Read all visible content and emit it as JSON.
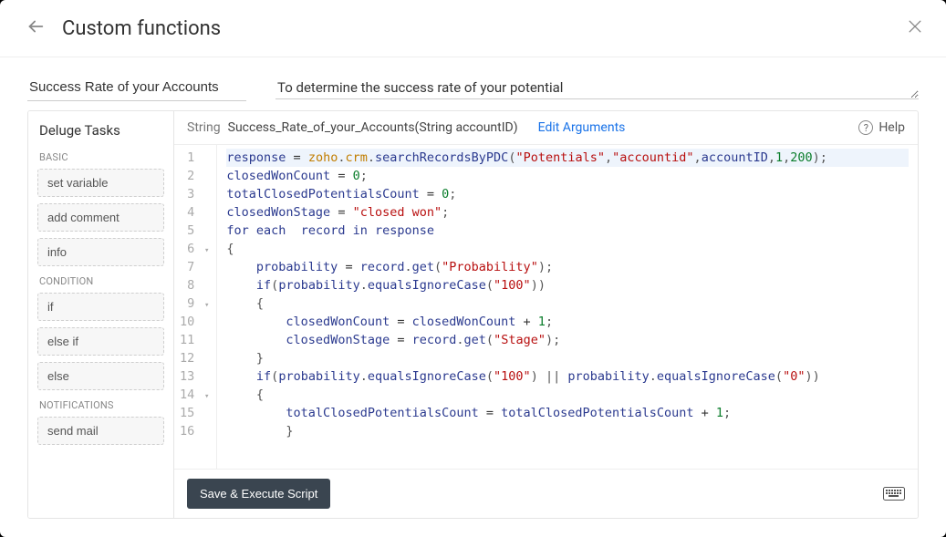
{
  "header": {
    "title": "Custom functions"
  },
  "form": {
    "function_name": "Success Rate of your Accounts",
    "description": "To determine the success rate of your potential"
  },
  "sidebar": {
    "title": "Deluge Tasks",
    "sections": [
      {
        "label": "BASIC",
        "items": [
          "set variable",
          "add comment",
          "info"
        ]
      },
      {
        "label": "CONDITION",
        "items": [
          "if",
          "else if",
          "else"
        ]
      },
      {
        "label": "NOTIFICATIONS",
        "items": [
          "send mail"
        ]
      }
    ]
  },
  "signature": {
    "return_type": "String",
    "func": "Success_Rate_of_your_Accounts(String accountID)",
    "edit_args_label": "Edit Arguments",
    "help_label": "Help"
  },
  "code": {
    "lines": [
      {
        "n": "1",
        "fold": "",
        "tokens": [
          [
            "var",
            "response"
          ],
          [
            "op",
            " = "
          ],
          [
            "obj",
            "zoho"
          ],
          [
            "punc",
            "."
          ],
          [
            "obj",
            "crm"
          ],
          [
            "punc",
            "."
          ],
          [
            "method",
            "searchRecordsByPDC"
          ],
          [
            "punc",
            "("
          ],
          [
            "str",
            "\"Potentials\""
          ],
          [
            "punc",
            ","
          ],
          [
            "str",
            "\"accountid\""
          ],
          [
            "punc",
            ","
          ],
          [
            "var",
            "accountID"
          ],
          [
            "punc",
            ","
          ],
          [
            "num",
            "1"
          ],
          [
            "punc",
            ","
          ],
          [
            "num",
            "200"
          ],
          [
            "punc",
            ");"
          ]
        ],
        "hl": true
      },
      {
        "n": "2",
        "fold": "",
        "tokens": [
          [
            "var",
            "closedWonCount"
          ],
          [
            "op",
            " = "
          ],
          [
            "num",
            "0"
          ],
          [
            "punc",
            ";"
          ]
        ]
      },
      {
        "n": "3",
        "fold": "",
        "tokens": [
          [
            "var",
            "totalClosedPotentialsCount"
          ],
          [
            "op",
            " = "
          ],
          [
            "num",
            "0"
          ],
          [
            "punc",
            ";"
          ]
        ]
      },
      {
        "n": "4",
        "fold": "",
        "tokens": [
          [
            "var",
            "closedWonStage"
          ],
          [
            "op",
            " = "
          ],
          [
            "str",
            "\"closed won\""
          ],
          [
            "punc",
            ";"
          ]
        ]
      },
      {
        "n": "5",
        "fold": "",
        "tokens": [
          [
            "kw",
            "for each"
          ],
          [
            "txt",
            "  "
          ],
          [
            "var",
            "record"
          ],
          [
            "txt",
            " "
          ],
          [
            "kw",
            "in"
          ],
          [
            "txt",
            " "
          ],
          [
            "var",
            "response"
          ]
        ]
      },
      {
        "n": "6",
        "fold": "▾",
        "tokens": [
          [
            "punc",
            "{"
          ]
        ]
      },
      {
        "n": "7",
        "fold": "",
        "tokens": [
          [
            "txt",
            "    "
          ],
          [
            "var",
            "probability"
          ],
          [
            "op",
            " = "
          ],
          [
            "var",
            "record"
          ],
          [
            "punc",
            "."
          ],
          [
            "method",
            "get"
          ],
          [
            "punc",
            "("
          ],
          [
            "str",
            "\"Probability\""
          ],
          [
            "punc",
            ");"
          ]
        ]
      },
      {
        "n": "8",
        "fold": "",
        "tokens": [
          [
            "txt",
            "    "
          ],
          [
            "kw",
            "if"
          ],
          [
            "punc",
            "("
          ],
          [
            "var",
            "probability"
          ],
          [
            "punc",
            "."
          ],
          [
            "method",
            "equalsIgnoreCase"
          ],
          [
            "punc",
            "("
          ],
          [
            "str",
            "\"100\""
          ],
          [
            "punc",
            "))"
          ]
        ]
      },
      {
        "n": "9",
        "fold": "▾",
        "tokens": [
          [
            "txt",
            "    "
          ],
          [
            "punc",
            "{"
          ]
        ]
      },
      {
        "n": "10",
        "fold": "",
        "tokens": [
          [
            "txt",
            "        "
          ],
          [
            "var",
            "closedWonCount"
          ],
          [
            "op",
            " = "
          ],
          [
            "var",
            "closedWonCount"
          ],
          [
            "op",
            " + "
          ],
          [
            "num",
            "1"
          ],
          [
            "punc",
            ";"
          ]
        ]
      },
      {
        "n": "11",
        "fold": "",
        "tokens": [
          [
            "txt",
            "        "
          ],
          [
            "var",
            "closedWonStage"
          ],
          [
            "op",
            " = "
          ],
          [
            "var",
            "record"
          ],
          [
            "punc",
            "."
          ],
          [
            "method",
            "get"
          ],
          [
            "punc",
            "("
          ],
          [
            "str",
            "\"Stage\""
          ],
          [
            "punc",
            ");"
          ]
        ]
      },
      {
        "n": "12",
        "fold": "",
        "tokens": [
          [
            "txt",
            "    "
          ],
          [
            "punc",
            "}"
          ]
        ]
      },
      {
        "n": "13",
        "fold": "",
        "tokens": [
          [
            "txt",
            "    "
          ],
          [
            "kw",
            "if"
          ],
          [
            "punc",
            "("
          ],
          [
            "var",
            "probability"
          ],
          [
            "punc",
            "."
          ],
          [
            "method",
            "equalsIgnoreCase"
          ],
          [
            "punc",
            "("
          ],
          [
            "str",
            "\"100\""
          ],
          [
            "punc",
            ") || "
          ],
          [
            "var",
            "probability"
          ],
          [
            "punc",
            "."
          ],
          [
            "method",
            "equalsIgnoreCase"
          ],
          [
            "punc",
            "("
          ],
          [
            "str",
            "\"0\""
          ],
          [
            "punc",
            "))"
          ]
        ]
      },
      {
        "n": "14",
        "fold": "▾",
        "tokens": [
          [
            "txt",
            "    "
          ],
          [
            "punc",
            "{"
          ]
        ]
      },
      {
        "n": "15",
        "fold": "",
        "tokens": [
          [
            "txt",
            "        "
          ],
          [
            "var",
            "totalClosedPotentialsCount"
          ],
          [
            "op",
            " = "
          ],
          [
            "var",
            "totalClosedPotentialsCount"
          ],
          [
            "op",
            " + "
          ],
          [
            "num",
            "1"
          ],
          [
            "punc",
            ";"
          ]
        ]
      },
      {
        "n": "16",
        "fold": "",
        "tokens": [
          [
            "txt",
            "        "
          ],
          [
            "punc",
            "}"
          ]
        ]
      }
    ]
  },
  "footer": {
    "save_label": "Save & Execute Script"
  }
}
